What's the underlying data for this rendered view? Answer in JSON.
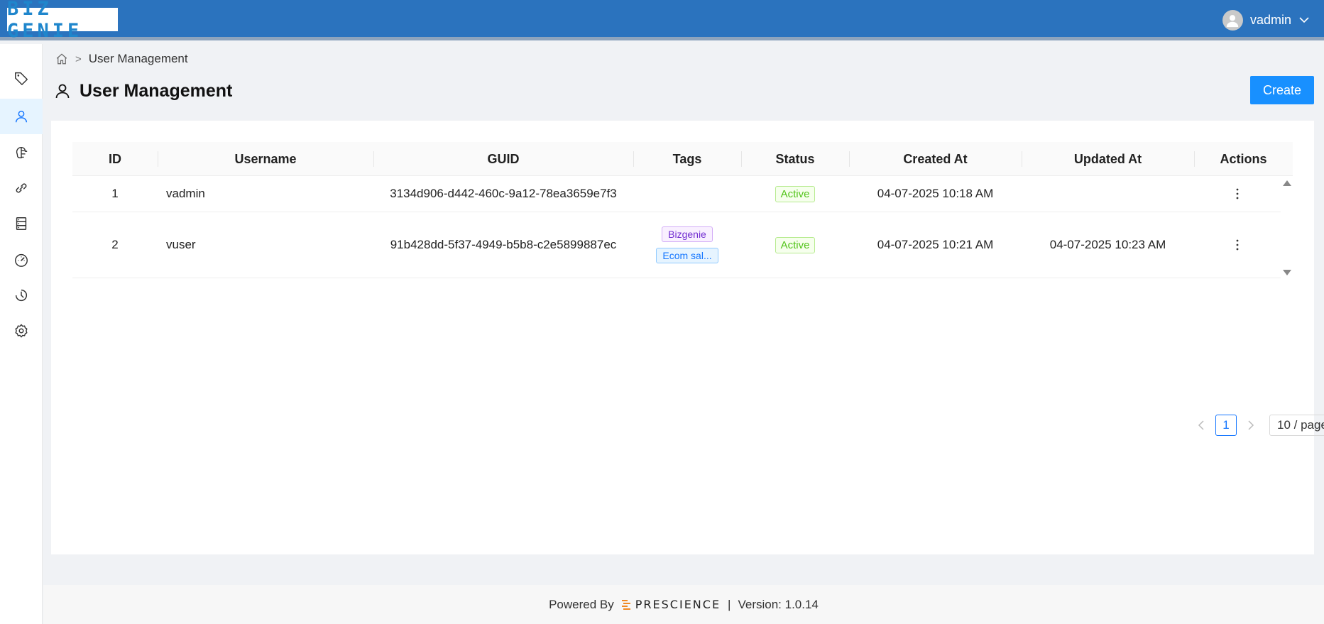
{
  "app": {
    "logo_text": "BIZ GENIE"
  },
  "header": {
    "username": "vadmin"
  },
  "sidebar": {
    "items": [
      {
        "name": "tag",
        "icon": "tag-icon",
        "active": false
      },
      {
        "name": "users",
        "icon": "user-icon",
        "active": true
      },
      {
        "name": "brain",
        "icon": "brain-icon",
        "active": false
      },
      {
        "name": "links",
        "icon": "link-icon",
        "active": false
      },
      {
        "name": "database",
        "icon": "database-icon",
        "active": false
      },
      {
        "name": "dashboard",
        "icon": "dashboard-icon",
        "active": false
      },
      {
        "name": "history",
        "icon": "history-icon",
        "active": false
      },
      {
        "name": "settings",
        "icon": "gear-icon",
        "active": false
      }
    ]
  },
  "breadcrumb": {
    "current": "User Management"
  },
  "page": {
    "title": "User Management",
    "create_label": "Create"
  },
  "table": {
    "columns": [
      "ID",
      "Username",
      "GUID",
      "Tags",
      "Status",
      "Created At",
      "Updated At",
      "Actions"
    ],
    "rows": [
      {
        "id": "1",
        "username": "vadmin",
        "guid": "3134d906-d442-460c-9a12-78ea3659e7f3",
        "tags": [],
        "status": "Active",
        "created": "04-07-2025 10:18 AM",
        "updated": ""
      },
      {
        "id": "2",
        "username": "vuser",
        "guid": "91b428dd-5f37-4949-b5b8-c2e5899887ec",
        "tags": [
          "Bizgenie",
          "Ecom sal..."
        ],
        "status": "Active",
        "created": "04-07-2025 10:21 AM",
        "updated": "04-07-2025 10:23 AM"
      }
    ]
  },
  "pagination": {
    "current_page": "1",
    "page_size": "10 / page"
  },
  "footer": {
    "powered_by": "Powered By",
    "brand": "PRESCIENCE",
    "separator": "|",
    "version": "Version: 1.0.14"
  },
  "colors": {
    "header": "#2b73be",
    "primary": "#1890ff",
    "active_green": "#52c41a"
  }
}
